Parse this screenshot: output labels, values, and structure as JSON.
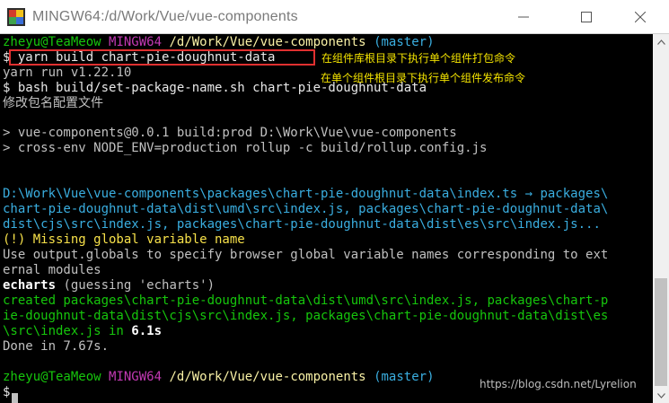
{
  "window": {
    "title": "MINGW64:/d/Work/Vue/vue-components",
    "app_icon": "mingw-icon",
    "controls": [
      "minimize-icon",
      "maximize-icon",
      "close-icon"
    ]
  },
  "terminal": {
    "prompt1": {
      "user": "zheyu@TeaMeow",
      "shell": "MINGW64",
      "path": "/d/Work/Vue/vue-components",
      "branch": "(master)"
    },
    "cmd1": "$ yarn build chart-pie-doughnut-data",
    "yarn_version": "yarn run v1.22.10",
    "cmd2": "$ bash build/set-package-name.sh chart-pie-doughnut-data",
    "set_name_msg": "修改包名配置文件",
    "npm_script": "> vue-components@0.0.1 build:prod D:\\Work\\Vue\\vue-components",
    "npm_cmd": "> cross-env NODE_ENV=production rollup -c build/rollup.config.js",
    "rollup_lines": [
      "D:\\Work\\Vue\\vue-components\\packages\\chart-pie-doughnut-data\\index.ts → packages\\",
      "chart-pie-doughnut-data\\dist\\umd\\src\\index.js, packages\\chart-pie-doughnut-data\\",
      "dist\\cjs\\src\\index.js, packages\\chart-pie-doughnut-data\\dist\\es\\src\\index.js..."
    ],
    "warning": "(!) Missing global variable name",
    "warning_detail": [
      "Use output.globals to specify browser global variable names corresponding to ext",
      "ernal modules"
    ],
    "guess_name": "echarts",
    "guess_rest": " (guessing 'echarts')",
    "created_lines": [
      "created packages\\chart-pie-doughnut-data\\dist\\umd\\src\\index.js, packages\\chart-p",
      "ie-doughnut-data\\dist\\cjs\\src\\index.js, packages\\chart-pie-doughnut-data\\dist\\es",
      "\\src\\index.js in "
    ],
    "created_time": "6.1s",
    "done": "Done in 7.67s.",
    "prompt2": {
      "user": "zheyu@TeaMeow",
      "shell": "MINGW64",
      "path": "/d/Work/Vue/vue-components",
      "branch": "(master)"
    },
    "final_prompt": "$"
  },
  "annotations": {
    "a1": "在组件库根目录下执行单个组件打包命令",
    "a2": "在单个组件根目录下执行单个组件发布命令"
  },
  "watermark": "https://blog.csdn.net/Lyrelion",
  "colors": {
    "prompt_green": "#16c60c",
    "shell_purple": "#c239b3",
    "path_yellow": "#f9f1a5",
    "branch_cyan": "#3aaee0",
    "annotation_box": "#e03030",
    "annotation_text": "#f5e500"
  }
}
